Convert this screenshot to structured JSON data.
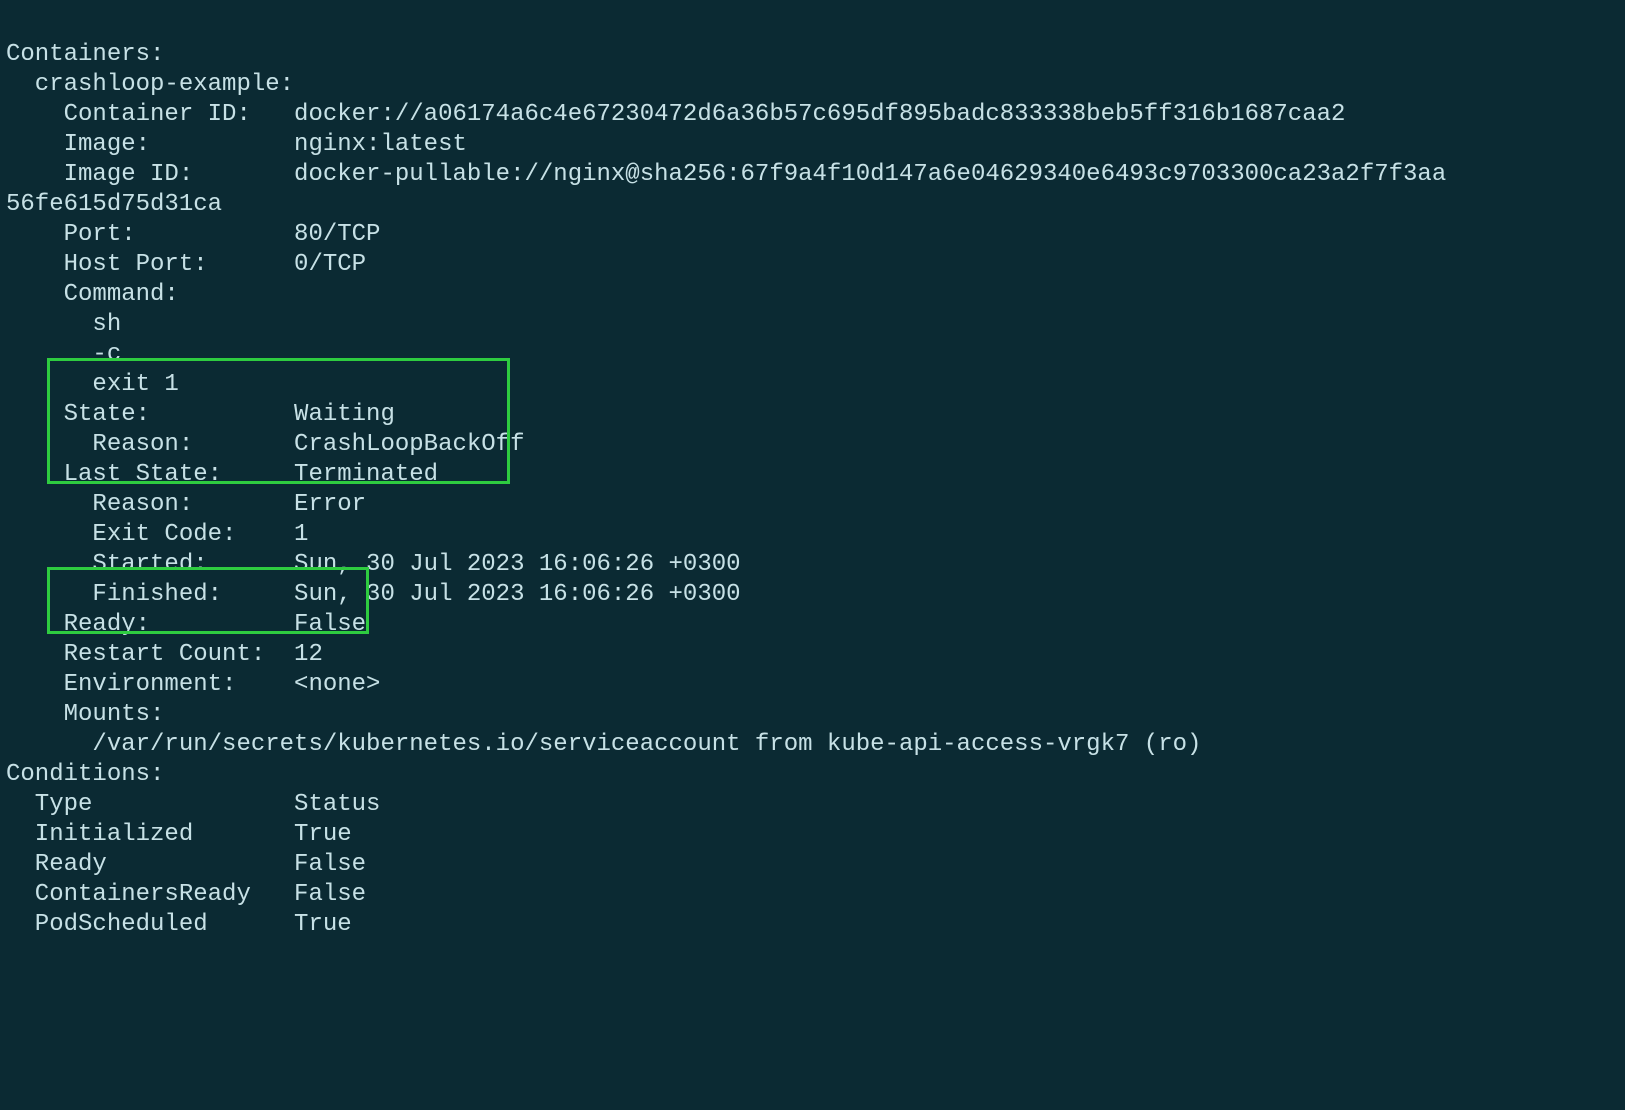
{
  "heading_containers": "Containers:",
  "container_name": "  crashloop-example:",
  "lines": {
    "container_id": "    Container ID:   docker://a06174a6c4e67230472d6a36b57c695df895badc833338beb5ff316b1687caa2",
    "image": "    Image:          nginx:latest",
    "image_id_a": "    Image ID:       docker-pullable://nginx@sha256:67f9a4f10d147a6e04629340e6493c9703300ca23a2f7f3aa",
    "image_id_b": "56fe615d75d31ca",
    "port": "    Port:           80/TCP",
    "host_port": "    Host Port:      0/TCP",
    "command": "    Command:",
    "cmd_sh": "      sh",
    "cmd_c": "      -c",
    "cmd_exit": "      exit 1",
    "state": "    State:          Waiting",
    "state_reason": "      Reason:       CrashLoopBackOff",
    "last_state": "    Last State:     Terminated",
    "ls_reason": "      Reason:       Error",
    "exit_code": "      Exit Code:    1",
    "started": "      Started:      Sun, 30 Jul 2023 16:06:26 +0300",
    "finished": "      Finished:     Sun, 30 Jul 2023 16:06:26 +0300",
    "ready": "    Ready:          False",
    "restart_count": "    Restart Count:  12",
    "environment": "    Environment:    <none>",
    "mounts": "    Mounts:",
    "mount_path": "      /var/run/secrets/kubernetes.io/serviceaccount from kube-api-access-vrgk7 (ro)"
  },
  "conditions_heading": "Conditions:",
  "conditions_header": "  Type              Status",
  "conditions": {
    "initialized": "  Initialized       True",
    "ready": "  Ready             False",
    "containers_ready": "  ContainersReady   False",
    "pod_scheduled": "  PodScheduled      True"
  }
}
